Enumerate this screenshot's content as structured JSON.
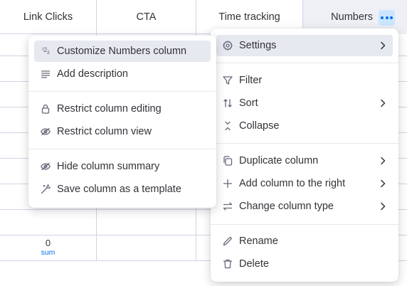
{
  "table": {
    "columns": [
      {
        "label": "Link Clicks"
      },
      {
        "label": "CTA"
      },
      {
        "label": "Time tracking"
      },
      {
        "label": "Numbers"
      }
    ],
    "summary": {
      "value": "0",
      "label": "sum"
    }
  },
  "main_menu": {
    "items": [
      {
        "label": "Settings",
        "icon": "gear-icon",
        "has_submenu": true
      },
      {
        "label": "Filter",
        "icon": "filter-icon",
        "has_submenu": false
      },
      {
        "label": "Sort",
        "icon": "sort-icon",
        "has_submenu": true
      },
      {
        "label": "Collapse",
        "icon": "collapse-icon",
        "has_submenu": false
      },
      {
        "label": "Duplicate column",
        "icon": "duplicate-icon",
        "has_submenu": true
      },
      {
        "label": "Add column to the right",
        "icon": "plus-icon",
        "has_submenu": true
      },
      {
        "label": "Change column type",
        "icon": "swap-icon",
        "has_submenu": true
      },
      {
        "label": "Rename",
        "icon": "pencil-icon",
        "has_submenu": false
      },
      {
        "label": "Delete",
        "icon": "trash-icon",
        "has_submenu": false
      }
    ]
  },
  "settings_submenu": {
    "items": [
      {
        "label": "Customize Numbers column",
        "icon": "numbers-icon"
      },
      {
        "label": "Add description",
        "icon": "description-icon"
      },
      {
        "label": "Restrict column editing",
        "icon": "lock-icon"
      },
      {
        "label": "Restrict column view",
        "icon": "eye-off-icon"
      },
      {
        "label": "Hide column summary",
        "icon": "eye-off-icon"
      },
      {
        "label": "Save column as a template",
        "icon": "magic-wand-icon"
      }
    ]
  },
  "colors": {
    "accent": "#0073ea",
    "highlight": "#e6e9ef",
    "border": "#d0d4e4"
  }
}
